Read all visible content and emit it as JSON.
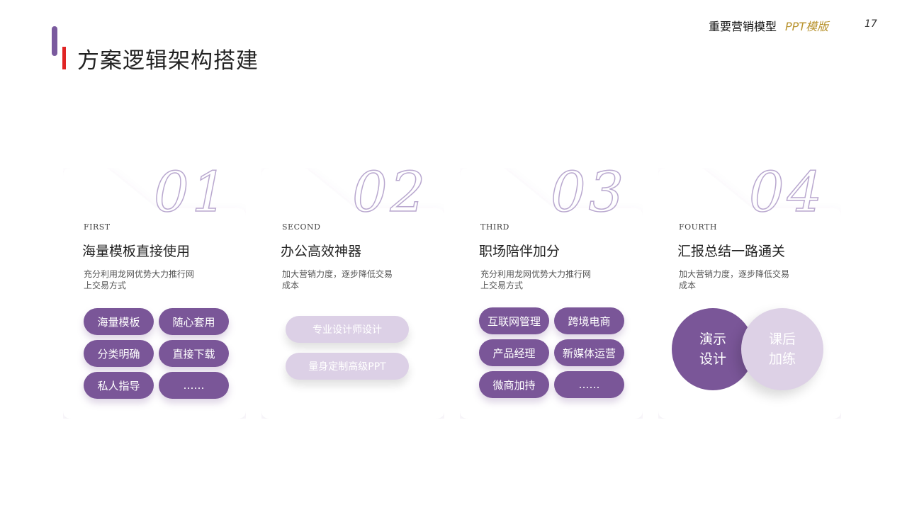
{
  "header": {
    "title": "方案逻辑架构搭建",
    "brand_main": "重要营销模型",
    "brand_sub": "PPT模版",
    "page_number": "17"
  },
  "cards": [
    {
      "number": "01",
      "label": "FIRST",
      "title": "海量模板直接使用",
      "description": "充分利用龙网优势大力推行网上交易方式",
      "tags": [
        "海量模板",
        "随心套用",
        "分类明确",
        "直接下载",
        "私人指导",
        "……"
      ]
    },
    {
      "number": "02",
      "label": "SECOND",
      "title": "办公高效神器",
      "description": "加大营销力度，逐步降低交易成本",
      "tags": [
        "专业设计师设计",
        "量身定制高级PPT"
      ]
    },
    {
      "number": "03",
      "label": "THIRD",
      "title": "职场陪伴加分",
      "description": "充分利用龙网优势大力推行网上交易方式",
      "tags": [
        "互联网管理",
        "跨境电商",
        "产品经理",
        "新媒体运营",
        "微商加持",
        "……"
      ]
    },
    {
      "number": "04",
      "label": "FOURTH",
      "title": "汇报总结一路通关",
      "description": "加大营销力度，逐步降低交易成本",
      "circles": [
        {
          "line1": "演示",
          "line2": "设计"
        },
        {
          "line1": "课后",
          "line2": "加练"
        }
      ]
    }
  ],
  "colors": {
    "accent_purple": "#7a5698",
    "light_purple": "#ddd1e6",
    "accent_red": "#e02424",
    "brand_gold": "#b8932e"
  }
}
